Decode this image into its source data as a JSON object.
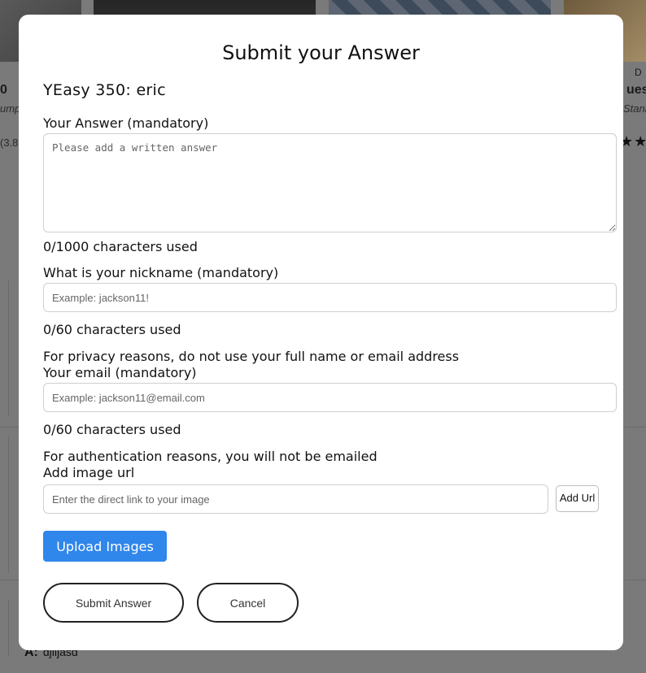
{
  "background": {
    "left_title": "0",
    "left_subtitle": "ump",
    "left_rating": "(3.8",
    "right_top": "D",
    "right_title": "ues",
    "right_subtitle": "Stanl",
    "right_stars": "★★",
    "answer_prefix": "A:",
    "answer_text": "djlljasd"
  },
  "modal": {
    "title": "Submit your Answer",
    "product": "YEasy 350: eric",
    "answer": {
      "label": "Your Answer (mandatory)",
      "value": "",
      "placeholder": "Please add a written answer",
      "counter": "0/1000 characters used"
    },
    "nickname": {
      "label": "What is your nickname (mandatory)",
      "value": "",
      "placeholder": "Example: jackson11!",
      "counter": "0/60 characters used",
      "note": "For privacy reasons, do not use your full name or email address"
    },
    "email": {
      "label": "Your email (mandatory)",
      "value": "",
      "placeholder": "Example: jackson11@email.com",
      "counter": "0/60 characters used",
      "note": "For authentication reasons, you will not be emailed"
    },
    "image": {
      "label": "Add image url",
      "value": "",
      "placeholder": "Enter the direct link to your image",
      "add_url_label": "Add Url"
    },
    "upload_label": "Upload Images",
    "submit_label": "Submit Answer",
    "cancel_label": "Cancel"
  },
  "colors": {
    "upload_button": "#2f86eb",
    "overlay": "#7a7a7a"
  }
}
